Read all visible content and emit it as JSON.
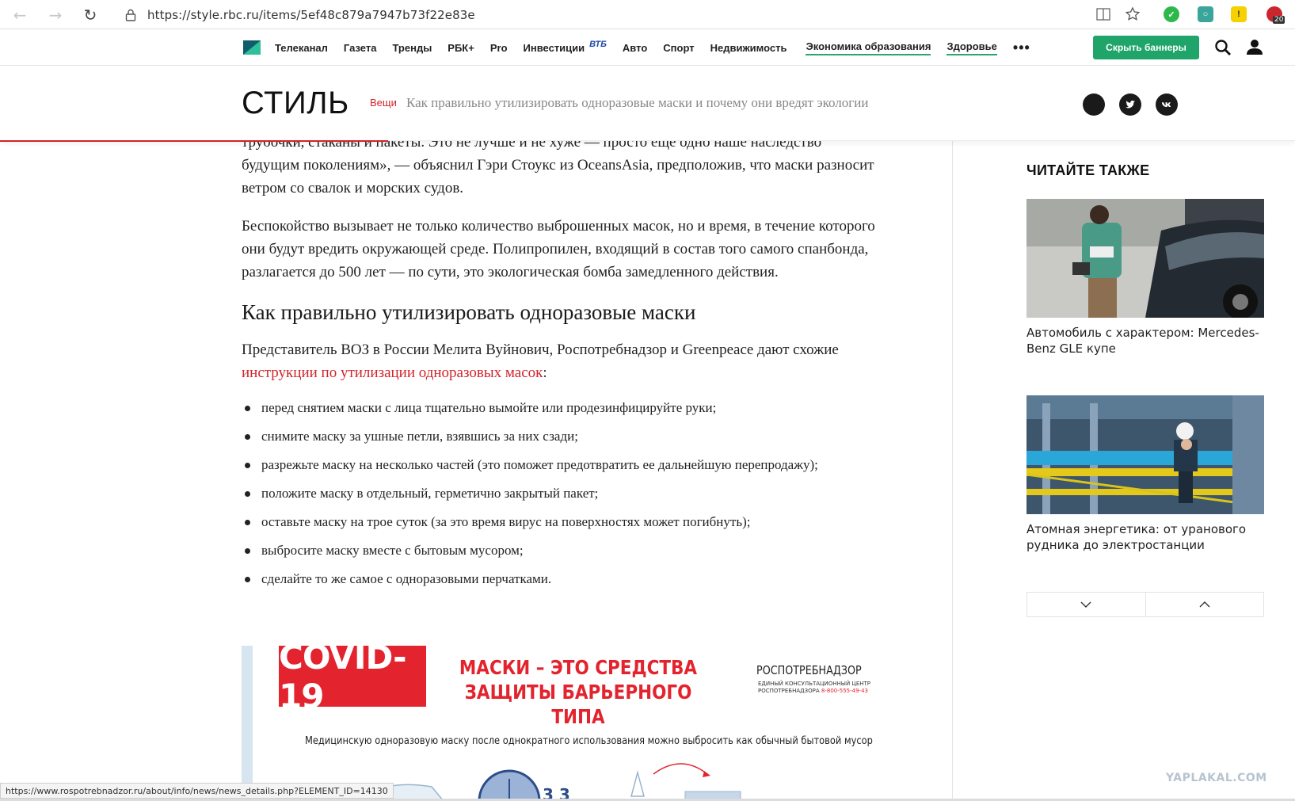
{
  "browser": {
    "url": "https://style.rbc.ru/items/5ef48c879a7947b73f22e83e",
    "badge_count": "20"
  },
  "topnav": {
    "items": [
      "Телеканал",
      "Газета",
      "Тренды",
      "РБК+",
      "Pro",
      "Инвестиции"
    ],
    "vtb_label": "ВТБ",
    "items2": [
      "Авто",
      "Спорт",
      "Недвижимость"
    ],
    "underlined": [
      "Экономика образования",
      "Здоровье"
    ],
    "more": "•••",
    "hide_banners": "Скрыть баннеры",
    "accent": "#1fa46a"
  },
  "section": {
    "title": "СТИЛЬ",
    "crumb": "Вещи",
    "headline": "Как правильно утилизировать одноразовые маски и почему они вредят экологии"
  },
  "article": {
    "p0": "трубочки, стаканы и пакеты. Это не лучше и не хуже — просто еще одно наше наследство будущим поколениям», — объяснил Гэри Стоукс из OceansAsia, предположив, что маски разносит ветром со свалок и морских судов.",
    "p1": "Беспокойство вызывает не только количество выброшенных масок, но и время, в течение которого они будут вредить окружающей среде. Полипропилен, входящий в состав того самого спанбонда, разлагается до 500 лет — по сути, это экологическая бомба замедленного действия.",
    "h2": "Как правильно утилизировать одноразовые маски",
    "p2_before": "Представитель ВОЗ в России Мелита Вуйнович, Роспотребнадзор и Greenpeace дают схожие ",
    "p2_link": "инструкции по утилизации одноразовых масок",
    "p2_after": ":",
    "bullets": [
      "перед снятием маски с лица тщательно вымойте или продезинфицируйте руки;",
      "снимите маску за ушные петли, взявшись за них сзади;",
      "разрежьте маску на несколько частей (это поможет предотвратить ее дальнейшую перепродажу);",
      "положите маску в отдельный, герметично закрытый пакет;",
      "оставьте маску на трое суток (за это время вирус на поверхностях может погибнуть);",
      "выбросите маску вместе с бытовым мусором;",
      "сделайте то же самое с одноразовыми перчатками."
    ]
  },
  "infographic": {
    "covid": "COVID-19",
    "title": "МАСКИ – ЭТО СРЕДСТВА ЗАЩИТЫ БАРЬЕРНОГО ТИПА",
    "org": "РОСПОТРЕБНАДЗОР",
    "org_sub1": "ЕДИНЫЙ КОНСУЛЬТАЦИОННЫЙ ЦЕНТР",
    "org_sub2": "РОСПОТРЕБНАДЗОРА",
    "phone": "8-800-555-49-43",
    "caption": "Медицинскую одноразовую маску после однократного использования можно выбросить как обычный бытовой мусор",
    "red": "#e3232d"
  },
  "sidebar": {
    "title": "ЧИТАЙТЕ ТАКЖЕ",
    "cards": [
      {
        "text": "Автомобиль с характером: Mercedes-Benz GLE купе"
      },
      {
        "text": "Атомная энергетика: от уранового рудника до электростанции"
      }
    ]
  },
  "status": {
    "link": "https://www.rospotrebnadzor.ru/about/info/news/news_details.php?ELEMENT_ID=14130"
  },
  "watermark": "YAPLAKAL.COM"
}
